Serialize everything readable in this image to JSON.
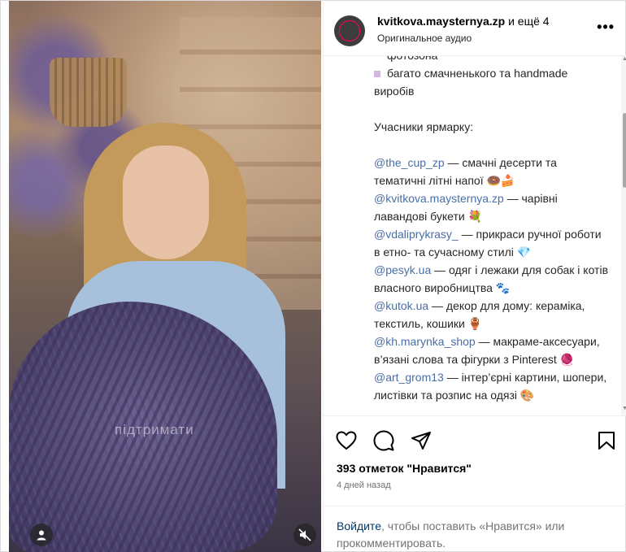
{
  "header": {
    "author": "kvitkova.maysternya.zp",
    "more_authors": "и ещё 4",
    "audio": "Оригинальное аудио",
    "more_button": "•••"
  },
  "media": {
    "watermark": "підтримати"
  },
  "caption": {
    "top_cutoff": "фотозона",
    "bullet_text": "багато смачненького та handmade виробів",
    "participants_heading": "Учасники ярмарку:",
    "participants": [
      {
        "handle": "@the_cup_zp",
        "text": " — смачні десерти та тематичні літні напої 🍩🍰"
      },
      {
        "handle": "@kvitkova.maysternya.zp",
        "text": " — чарівні лавандові букети 💐"
      },
      {
        "handle": "@vdaliprykrasy_",
        "text": " — прикраси ручної роботи в етно- та сучасному стилі 💎"
      },
      {
        "handle": "@pesyk.ua",
        "text": " — одяг і лежаки для собак і котів власного виробництва 🐾"
      },
      {
        "handle": "@kutok.ua",
        "text": " — декор для дому: кераміка, текстиль, кошики 🏺"
      },
      {
        "handle": "@kh.marynka_shop",
        "text": " — макраме-аксесуари, в’язані слова та фігурки з Pinterest 🧶"
      },
      {
        "handle": "@art_grom13",
        "text": " — інтер’єрні картини, шопери, листівки та розпис на одязі 🎨"
      }
    ]
  },
  "footer": {
    "likes": "393 отметок \"Нравится\"",
    "time": "4 дней назад",
    "login_link": "Войдите",
    "login_rest": ", чтобы поставить «Нравится» или прокомментировать."
  },
  "icons": {
    "like": "heart-icon",
    "comment": "comment-icon",
    "share": "share-icon",
    "save": "bookmark-icon",
    "user": "user-icon",
    "mute": "muted-speaker-icon"
  }
}
